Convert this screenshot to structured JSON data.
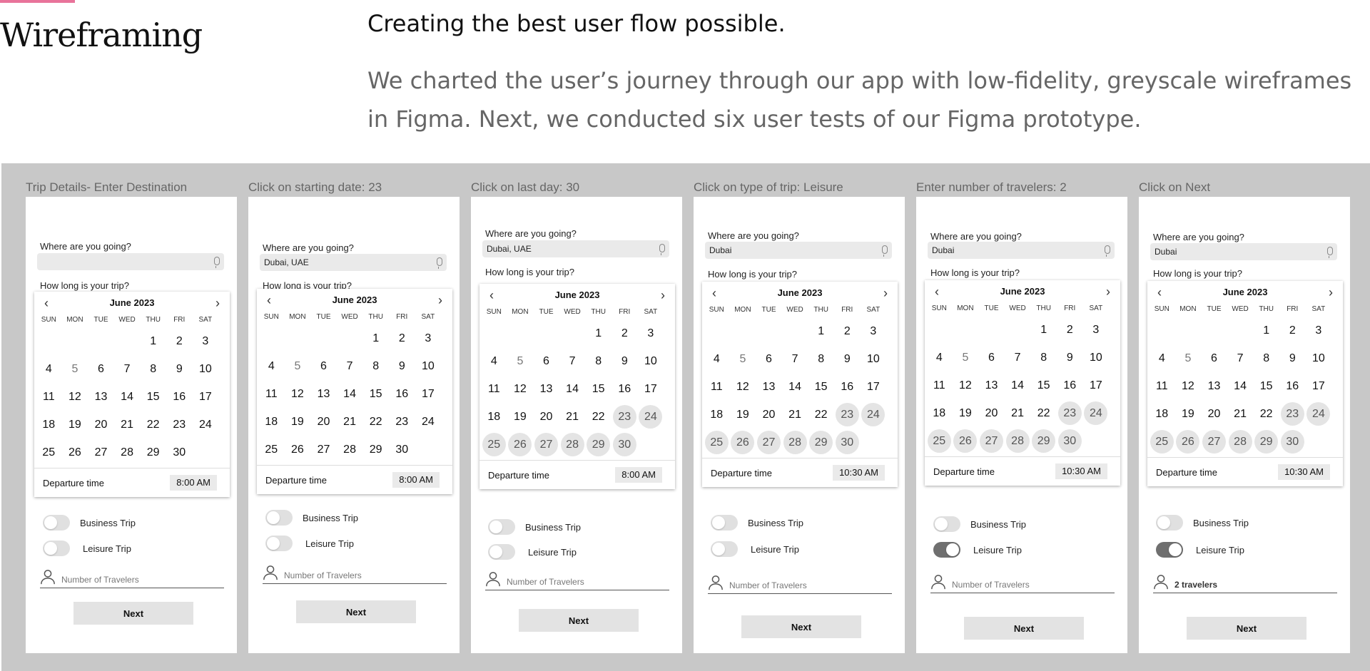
{
  "header": {
    "section_title": "Wireframing",
    "headline": "Creating the best user flow possible.",
    "body": "We charted the user’s journey through our app with low-fidelity, greyscale wireframes in Figma. Next, we conducted six user tests of our Figma prototype."
  },
  "colors": {
    "accent": "#e8739a",
    "panel": "#c8c8c8",
    "toggle_on": "#6f6f6f"
  },
  "common": {
    "where_label": "Where are you going?",
    "how_long_label": "How long is your trip?",
    "month": "June 2023",
    "weekdays": [
      "SUN",
      "MON",
      "TUE",
      "WED",
      "THU",
      "FRI",
      "SAT"
    ],
    "departure_label": "Departure time",
    "business_label": "Business Trip",
    "leisure_label": "Leisure Trip",
    "travelers_placeholder": "Number of Travelers",
    "next_label": "Next",
    "prev_icon": "chevron-left-icon",
    "next_icon": "chevron-right-icon"
  },
  "frames": [
    {
      "caption": "Trip Details- Enter Destination",
      "destination": "",
      "selected_days": [],
      "departure_time": "8:00 AM",
      "business_on": false,
      "leisure_on": false,
      "travelers": ""
    },
    {
      "caption": "Click on starting date: 23",
      "destination": "Dubai, UAE",
      "selected_days": [],
      "departure_time": "8:00 AM",
      "business_on": false,
      "leisure_on": false,
      "travelers": ""
    },
    {
      "caption": "Click on last day: 30",
      "destination": "Dubai, UAE",
      "selected_days": [
        23,
        24,
        25,
        26,
        27,
        28,
        29,
        30
      ],
      "departure_time": "8:00 AM",
      "business_on": false,
      "leisure_on": false,
      "travelers": ""
    },
    {
      "caption": "Click on type of trip: Leisure",
      "destination": "Dubai",
      "selected_days": [
        23,
        24,
        25,
        26,
        27,
        28,
        29,
        30
      ],
      "departure_time": "10:30 AM",
      "business_on": false,
      "leisure_on": false,
      "travelers": ""
    },
    {
      "caption": "Enter number of travelers: 2",
      "destination": "Dubai",
      "selected_days": [
        23,
        24,
        25,
        26,
        27,
        28,
        29,
        30
      ],
      "departure_time": "10:30 AM",
      "business_on": false,
      "leisure_on": true,
      "travelers": ""
    },
    {
      "caption": "Click on Next",
      "destination": "Dubai",
      "selected_days": [
        23,
        24,
        25,
        26,
        27,
        28,
        29,
        30
      ],
      "departure_time": "10:30 AM",
      "business_on": false,
      "leisure_on": true,
      "travelers": "2 travelers"
    }
  ]
}
